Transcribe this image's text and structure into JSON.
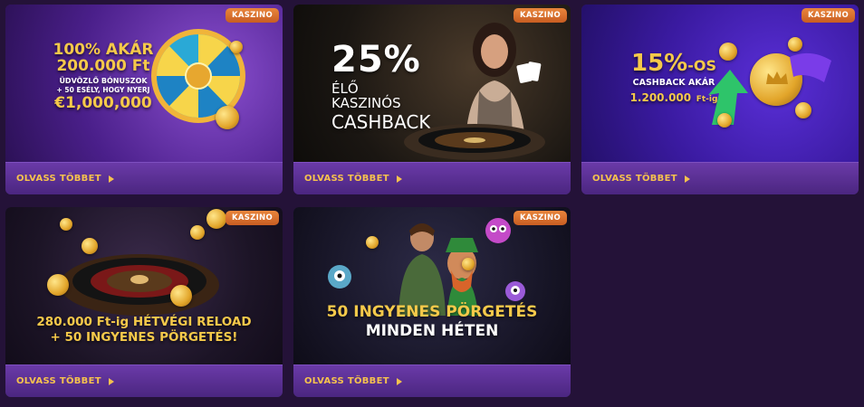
{
  "cards": [
    {
      "badge": "KASZINO",
      "line1": "100% AKÁR",
      "line2": "200.000 Ft",
      "line3": "ÜDVÖZLŐ BÓNUSZOK",
      "line4": "+ 50 ESÉLY, HOGY NYERJ",
      "line5": "€1,000,000",
      "cta": "OLVASS TÖBBET"
    },
    {
      "badge": "KASZINO",
      "line1": "25%",
      "line2": "ÉLŐ KASZINÓS",
      "line3": "CASHBACK",
      "cta": "OLVASS TÖBBET"
    },
    {
      "badge": "KASZINO",
      "line1": "15%",
      "line1b": "-OS",
      "line2": "CASHBACK AKÁR",
      "line3": "1.200.000",
      "line3b": "Ft-ig",
      "cta": "OLVASS TÖBBET"
    },
    {
      "badge": "KASZINO",
      "line1": "280.000 Ft-ig HÉTVÉGI RELOAD",
      "line2": "+ 50 INGYENES PÖRGETÉS!",
      "cta": "OLVASS TÖBBET"
    },
    {
      "badge": "KASZINO",
      "line1": "50 INGYENES PÖRGETÉS",
      "line2": "MINDEN HÉTEN",
      "cta": "OLVASS TÖBBET"
    }
  ]
}
